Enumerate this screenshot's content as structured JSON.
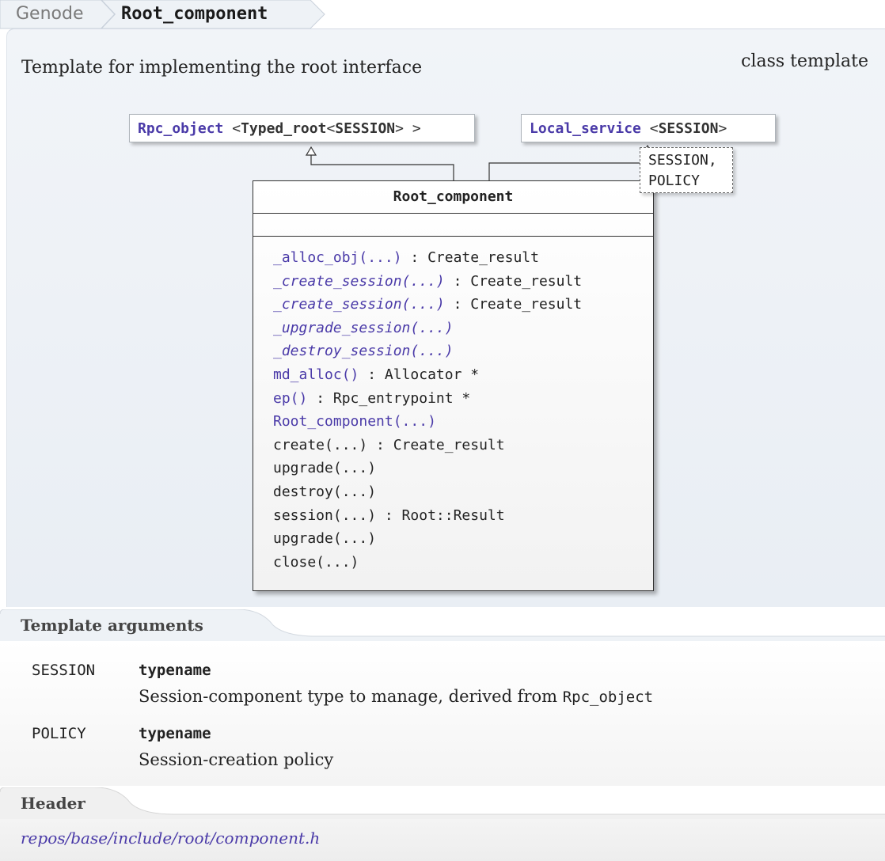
{
  "breadcrumb": {
    "parent": "Genode",
    "current": "Root_component"
  },
  "summary": "Template for implementing the root interface",
  "kind": "class template",
  "bases": [
    {
      "name": "Rpc_object",
      "args_pre": " <",
      "arg": "Typed_root",
      "arg_mid": "<",
      "arg_inner": "SESSION",
      "args_post": "> >"
    },
    {
      "name": "Local_service",
      "args_pre": " <",
      "arg": "SESSION",
      "args_post": ">"
    }
  ],
  "template_params": [
    "SESSION,",
    "POLICY"
  ],
  "class_name": "Root_component",
  "methods": [
    {
      "name": "_alloc_obj(...)",
      "ret": " : Create_result",
      "style": "link"
    },
    {
      "name": "_create_session(...)",
      "ret": " : Create_result",
      "style": "ilink"
    },
    {
      "name": "_create_session(...)",
      "ret": " : Create_result",
      "style": "ilink"
    },
    {
      "name": "_upgrade_session(...)",
      "ret": "",
      "style": "ilink"
    },
    {
      "name": "_destroy_session(...)",
      "ret": "",
      "style": "ilink"
    },
    {
      "name": "md_alloc()",
      "ret": " : Allocator *",
      "style": "link"
    },
    {
      "name": "ep()",
      "ret": " : Rpc_entrypoint *",
      "style": "link"
    },
    {
      "name": "Root_component(...)",
      "ret": "",
      "style": "link"
    },
    {
      "name": "create(...)",
      "ret": " : Create_result",
      "style": "plain"
    },
    {
      "name": "upgrade(...)",
      "ret": "",
      "style": "plain"
    },
    {
      "name": "destroy(...)",
      "ret": "",
      "style": "plain"
    },
    {
      "name": "session(...)",
      "ret": " : Root::Result",
      "style": "plain"
    },
    {
      "name": "upgrade(...)",
      "ret": "",
      "style": "plain"
    },
    {
      "name": "close(...)",
      "ret": "",
      "style": "plain"
    }
  ],
  "sections": {
    "template_arguments": "Template arguments",
    "header": "Header"
  },
  "template_arguments": [
    {
      "name": "SESSION",
      "type": "typename",
      "desc": "Session-component type to manage, derived from ",
      "desc_code": "Rpc_object"
    },
    {
      "name": "POLICY",
      "type": "typename",
      "desc": "Session-creation policy",
      "desc_code": ""
    }
  ],
  "header_path": "repos/base/include/root/component.h",
  "colors": {
    "link": "#4a3aa8",
    "panel": "#eef2f6",
    "breadcrumb_bg": "#eef2f6"
  }
}
